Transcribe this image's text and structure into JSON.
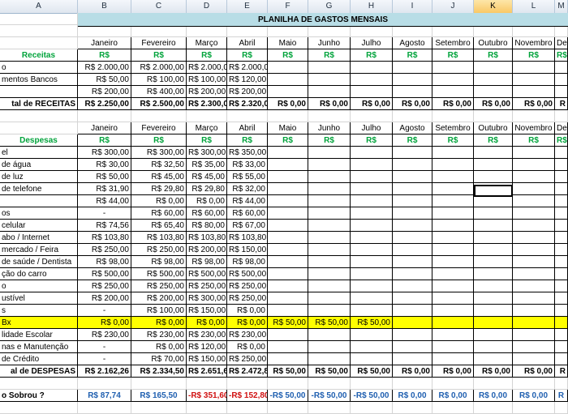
{
  "col_headers": [
    "A",
    "B",
    "C",
    "D",
    "E",
    "F",
    "G",
    "H",
    "I",
    "J",
    "K",
    "L",
    "M"
  ],
  "selected_col": "K",
  "title": "PLANILHA DE GASTOS MENSAIS",
  "months": [
    "Janeiro",
    "Fevereiro",
    "Março",
    "Abril",
    "Maio",
    "Junho",
    "Julho",
    "Agosto",
    "Setembro",
    "Outubro",
    "Novembro",
    "De"
  ],
  "currency": "R$",
  "receitas": {
    "heading": "Receitas",
    "rows": [
      {
        "label": "o",
        "values": [
          "R$ 2.000,00",
          "R$ 2.000,00",
          "R$ 2.000,00",
          "R$ 2.000,00"
        ]
      },
      {
        "label": "mentos Bancos",
        "values": [
          "R$ 50,00",
          "R$ 100,00",
          "R$ 100,00",
          "R$ 120,00"
        ]
      },
      {
        "label": "",
        "values": [
          "R$ 200,00",
          "R$ 400,00",
          "R$ 200,00",
          "R$ 200,00"
        ]
      }
    ],
    "total_label": "tal de RECEITAS",
    "totals": [
      "R$ 2.250,00",
      "R$ 2.500,00",
      "R$ 2.300,00",
      "R$ 2.320,00",
      "R$ 0,00",
      "R$ 0,00",
      "R$ 0,00",
      "R$ 0,00",
      "R$ 0,00",
      "R$ 0,00",
      "R$ 0,00",
      "R"
    ]
  },
  "despesas": {
    "heading": "Despesas",
    "rows": [
      {
        "label": "el",
        "values": [
          "R$ 300,00",
          "R$ 300,00",
          "R$ 300,00",
          "R$ 350,00"
        ]
      },
      {
        "label": "de água",
        "values": [
          "R$ 30,00",
          "R$ 32,50",
          "R$ 35,00",
          "R$ 33,00"
        ]
      },
      {
        "label": "de luz",
        "values": [
          "R$ 50,00",
          "R$ 45,00",
          "R$ 45,00",
          "R$ 55,00"
        ]
      },
      {
        "label": "de telefone",
        "values": [
          "R$ 31,90",
          "R$ 29,80",
          "R$ 29,80",
          "R$ 32,00"
        ]
      },
      {
        "label": "",
        "values": [
          "R$ 44,00",
          "R$ 0,00",
          "R$ 0,00",
          "R$ 44,00"
        ]
      },
      {
        "label": "os",
        "values": [
          "-",
          "R$ 60,00",
          "R$ 60,00",
          "R$ 60,00"
        ]
      },
      {
        "label": "celular",
        "values": [
          "R$ 74,56",
          "R$ 65,40",
          "R$ 80,00",
          "R$ 67,00"
        ]
      },
      {
        "label": "abo / Internet",
        "values": [
          "R$ 103,80",
          "R$ 103,80",
          "R$ 103,80",
          "R$ 103,80"
        ]
      },
      {
        "label": "mercado / Feira",
        "values": [
          "R$ 250,00",
          "R$ 250,00",
          "R$ 200,00",
          "R$ 150,00"
        ]
      },
      {
        "label": "de saúde / Dentista",
        "values": [
          "R$ 98,00",
          "R$ 98,00",
          "R$ 98,00",
          "R$ 98,00"
        ]
      },
      {
        "label": "ção do carro",
        "values": [
          "R$ 500,00",
          "R$ 500,00",
          "R$ 500,00",
          "R$ 500,00"
        ]
      },
      {
        "label": "o",
        "values": [
          "R$ 250,00",
          "R$ 250,00",
          "R$ 250,00",
          "R$ 250,00"
        ]
      },
      {
        "label": "ustível",
        "values": [
          "R$ 200,00",
          "R$ 200,00",
          "R$ 300,00",
          "R$ 250,00"
        ]
      },
      {
        "label": "s",
        "values": [
          "-",
          "R$ 100,00",
          "R$ 150,00",
          "R$ 0,00"
        ]
      },
      {
        "label": "Bx",
        "values": [
          "R$ 0,00",
          "R$ 0,00",
          "R$ 0,00",
          "R$ 0,00",
          "R$ 50,00",
          "R$ 50,00",
          "R$ 50,00"
        ],
        "highlight": true
      },
      {
        "label": "lidade Escolar",
        "values": [
          "R$ 230,00",
          "R$ 230,00",
          "R$ 230,00",
          "R$ 230,00"
        ]
      },
      {
        "label": "nas e Manutenção",
        "values": [
          "-",
          "R$ 0,00",
          "R$ 120,00",
          "R$ 0,00"
        ]
      },
      {
        "label": "de Crédito",
        "values": [
          "-",
          "R$ 70,00",
          "R$ 150,00",
          "R$ 250,00"
        ]
      }
    ],
    "total_label": "al de DESPESAS",
    "totals": [
      "R$ 2.162,26",
      "R$ 2.334,50",
      "R$ 2.651,60",
      "R$ 2.472,80",
      "R$ 50,00",
      "R$ 50,00",
      "R$ 50,00",
      "R$ 0,00",
      "R$ 0,00",
      "R$ 0,00",
      "R$ 0,00",
      "R"
    ]
  },
  "sobrou": {
    "label": "o Sobrou ?",
    "values": [
      "R$ 87,74",
      "R$ 165,50",
      "-R$ 351,60",
      "-R$ 152,80",
      "-R$ 50,00",
      "-R$ 50,00",
      "-R$ 50,00",
      "R$ 0,00",
      "R$ 0,00",
      "R$ 0,00",
      "R$ 0,00",
      "R"
    ],
    "negative": [
      false,
      false,
      true,
      true,
      false,
      false,
      false,
      false,
      false,
      false,
      false,
      false
    ]
  },
  "colors": {
    "title_bg": "#b8dde6",
    "highlight": "#ffff00",
    "green": "#00a33b",
    "blue": "#1f5fb0",
    "red": "#d01010"
  }
}
